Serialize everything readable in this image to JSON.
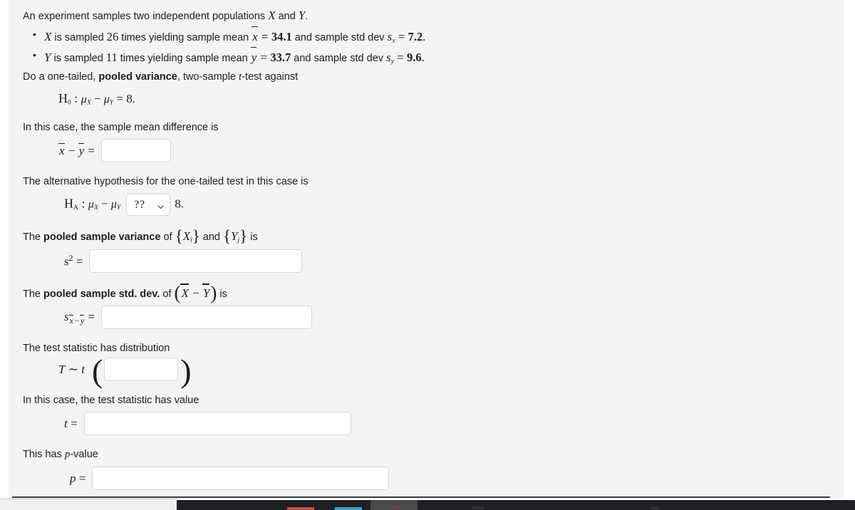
{
  "problem": {
    "intro_prefix": "An experiment samples two independent populations ",
    "intro_var_x": "X",
    "intro_and": " and ",
    "intro_var_y": "Y",
    "intro_suffix": ".",
    "bullets": [
      {
        "var": "X",
        "text_1": " is sampled ",
        "count": "26",
        "text_2": " times yielding sample mean ",
        "mean_sym": "x",
        "eq_1": " = ",
        "mean_val": "34.1",
        "text_3": " and sample std dev ",
        "sd_sym": "s",
        "sd_sub": "x",
        "eq_2": " = ",
        "sd_val": "7.2",
        "period": "."
      },
      {
        "var": "Y",
        "text_1": " is sampled ",
        "count": "11",
        "text_2": " times yielding sample mean ",
        "mean_sym": "y",
        "eq_1": " = ",
        "mean_val": "33.7",
        "text_3": " and sample std dev ",
        "sd_sym": "s",
        "sd_sub": "y",
        "eq_2": " = ",
        "sd_val": "9.6",
        "period": "."
      }
    ],
    "instruction_pre": "Do a one-tailed, ",
    "instruction_bold": "pooled variance",
    "instruction_mid": ", two-sample ",
    "instruction_t": "t",
    "instruction_post": "-test against",
    "h0_label": "H",
    "h0_sub": "0",
    "h0_colon": " :  ",
    "h0_mu_x": "μ",
    "h0_mu_x_sub": "X",
    "h0_minus": " − ",
    "h0_mu_y": "μ",
    "h0_mu_y_sub": "Y",
    "h0_eq": " = ",
    "h0_value": "8."
  },
  "sections": {
    "mean_diff": {
      "prompt": "In this case, the sample mean difference is",
      "label_x": "x",
      "label_minus": " − ",
      "label_y": "y",
      "label_eq": " = ",
      "input_value": "",
      "input_placeholder": ""
    },
    "alt_hypothesis": {
      "prompt": "The alternative hypothesis for the one-tailed test in this case is",
      "label_h": "H",
      "label_sub": "A",
      "label_colon": " :  ",
      "mu_x": "μ",
      "mu_x_sub": "X",
      "minus": " − ",
      "mu_y": "μ",
      "mu_y_sub": "Y",
      "dropdown_value": "??",
      "dropdown_icon": "chevron-down-icon",
      "trailing_value": "8."
    },
    "pooled_variance": {
      "prompt_pre": "The ",
      "prompt_bold": "pooled sample variance",
      "prompt_of": " of ",
      "set_x_open": "{",
      "set_x": "X",
      "set_x_sub": "i",
      "set_x_close": "}",
      "prompt_and": " and ",
      "set_y_open": "{",
      "set_y": "Y",
      "set_y_sub": "j",
      "set_y_close": "}",
      "prompt_is": " is",
      "label_s": "s",
      "label_sup": "2",
      "label_eq": " = ",
      "input_value": "",
      "input_placeholder": ""
    },
    "pooled_std_dev": {
      "prompt_pre": "The ",
      "prompt_bold": "pooled sample std. dev.",
      "prompt_of": " of ",
      "paren_open": "(",
      "var_x": "X",
      "minus": " − ",
      "var_y": "Y",
      "paren_close": ")",
      "prompt_is": " is",
      "label_s": "s",
      "label_sub_x": "x",
      "label_sub_minus": "−",
      "label_sub_y": "y",
      "label_eq": " = ",
      "input_value": "",
      "input_placeholder": ""
    },
    "distribution": {
      "prompt": "The test statistic has distribution",
      "label_T": "T",
      "label_tilde": " ∼ ",
      "label_t": "t",
      "paren_open": "(",
      "paren_close": ")",
      "input_value": "",
      "input_placeholder": ""
    },
    "test_statistic": {
      "prompt": "In this case, the test statistic has value",
      "label_t": "t",
      "label_eq": " = ",
      "input_value": "",
      "input_placeholder": ""
    },
    "p_value": {
      "prompt_pre": "This has ",
      "prompt_italic": "p",
      "prompt_post": "-value",
      "label_p": "p",
      "label_eq": " = ",
      "input_value": "",
      "input_placeholder": ""
    }
  },
  "colors": {
    "page_background": "#f4f4f4",
    "text": "#1d1d1d",
    "input_border": "#d6d6d6",
    "input_background": "#ffffff",
    "taskbar": "#1e2024",
    "taskbar_accent_red": "#e0453c",
    "taskbar_accent_blue": "#2aa8d8"
  }
}
